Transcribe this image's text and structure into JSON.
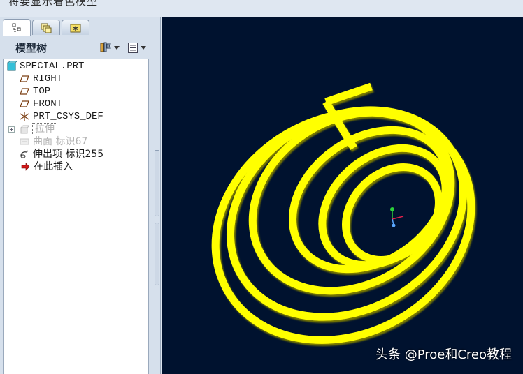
{
  "window": {
    "title": "将要显示着色模型"
  },
  "tabs": [
    {
      "icon": "model-tree-icon",
      "active": true
    },
    {
      "icon": "folder-browser-icon",
      "active": false
    },
    {
      "icon": "favorites-icon",
      "active": false
    }
  ],
  "model_tree": {
    "title": "模型树",
    "settings_icon": "tree-settings-icon",
    "show_icon": "tree-show-icon",
    "items": [
      {
        "label": "SPECIAL.PRT",
        "icon": "part-icon"
      },
      {
        "label": "RIGHT",
        "icon": "datum-plane-icon"
      },
      {
        "label": "TOP",
        "icon": "datum-plane-icon"
      },
      {
        "label": "FRONT",
        "icon": "datum-plane-icon"
      },
      {
        "label": "PRT_CSYS_DEF",
        "icon": "csys-icon"
      },
      {
        "label": "拉伸",
        "icon": "extrude-icon",
        "state": "suppressed-selected"
      },
      {
        "label": "曲面 标识67",
        "icon": "surface-icon",
        "state": "suppressed"
      },
      {
        "label": "伸出项 标识255",
        "icon": "protrusion-icon"
      },
      {
        "label": "在此插入",
        "icon": "insert-here-arrow-icon"
      }
    ]
  },
  "viewport": {
    "background": "#00122f",
    "model_color": "#ffff00",
    "watermark": "头条 @Proe和Creo教程"
  }
}
